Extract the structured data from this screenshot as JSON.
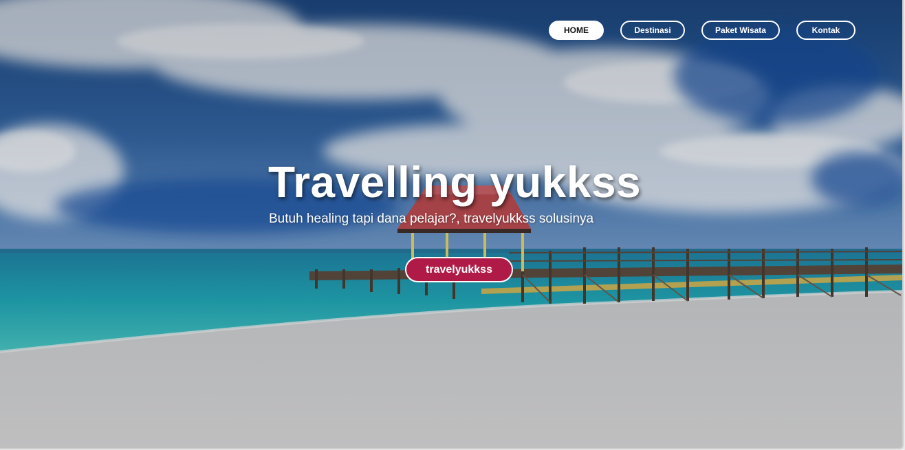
{
  "nav": {
    "items": [
      {
        "label": "HOME",
        "active": true
      },
      {
        "label": "Destinasi",
        "active": false
      },
      {
        "label": "Paket Wisata",
        "active": false
      },
      {
        "label": "Kontak",
        "active": false
      }
    ]
  },
  "hero": {
    "title": "Travelling yukkss",
    "subtitle": "Butuh healing tapi dana pelajar?, travelyukkss solusinya",
    "cta_label": "travelyukkss"
  },
  "colors": {
    "cta_background": "#b01a47",
    "nav_active_background": "#ffffff",
    "text": "#ffffff"
  },
  "background": {
    "scene": "beach-pier-photo"
  }
}
